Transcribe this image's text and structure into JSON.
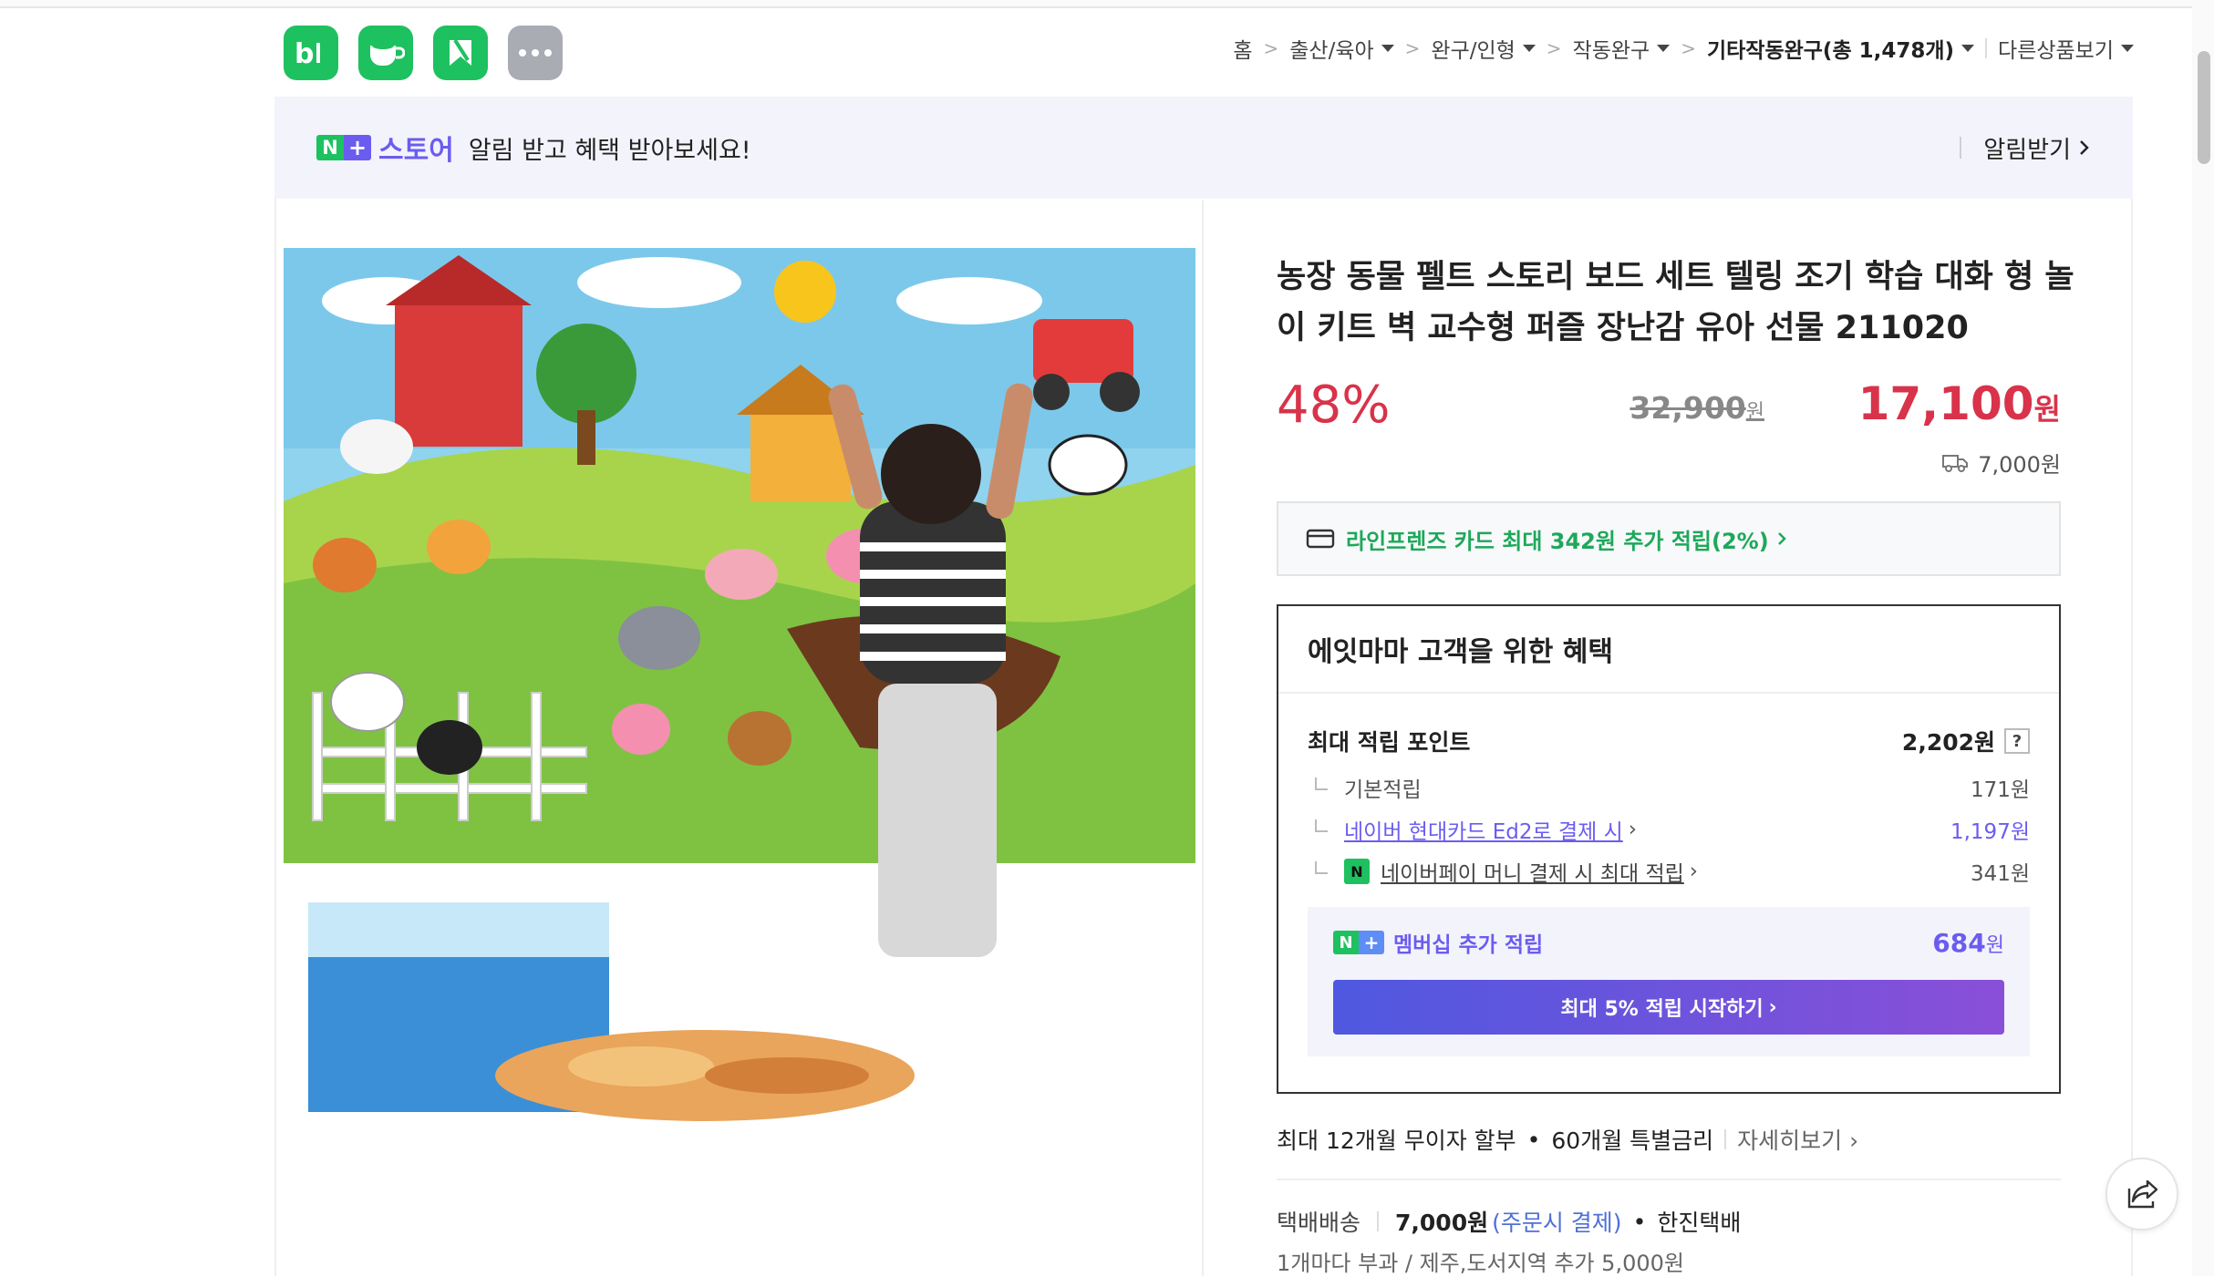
{
  "colors": {
    "green": "#1ec15f",
    "purple": "#6b5cf0",
    "red": "#d8334a",
    "grey_icon": "#a9acb3"
  },
  "apps": [
    {
      "name": "blog-icon"
    },
    {
      "name": "cafe-icon"
    },
    {
      "name": "post-icon"
    },
    {
      "name": "more-icon"
    }
  ],
  "breadcrumb": {
    "home": "홈",
    "c1": "출산/육아",
    "c2": "완구/인형",
    "c3": "작동완구",
    "c4": "기타작동완구(총 1,478개)",
    "other": "다른상품보기"
  },
  "store_bar": {
    "n": "N",
    "plus": "+",
    "store": "스토어",
    "message": "알림 받고 혜택 받아보세요!",
    "alarm": "알림받기"
  },
  "product": {
    "title": "농장 동물 펠트 스토리 보드 세트 텔링 조기 학습 대화 형 놀이 키트 벽 교수형 퍼즐 장난감 유아 선물 211020",
    "discount": "48%",
    "original_price": "32,900",
    "original_unit": "원",
    "sale_price": "17,100",
    "sale_unit": "원",
    "shipping_fee": "7,000원"
  },
  "card_benefit": "라인프렌즈 카드 최대 342원 추가 적립(2%)",
  "benefit": {
    "header": "에잇마마 고객을 위한 혜택",
    "max_points_label": "최대 적립 포인트",
    "max_points_value": "2,202원",
    "q": "?",
    "base_label": "기본적립",
    "base_value": "171원",
    "hyundai_label": "네이버 현대카드 Ed2로 결제 시",
    "hyundai_value": "1,197원",
    "npay_icon": "N",
    "npay_label": "네이버페이 머니 결제 시 최대 적립",
    "npay_value": "341원",
    "member_label": "멤버십 추가 적립",
    "member_value": "684",
    "member_unit": "원",
    "member_button": "최대 5% 적립 시작하기"
  },
  "installment": {
    "text1": "최대 12개월 무이자 할부",
    "dot": "•",
    "text2": "60개월 특별금리",
    "more": "자세히보기"
  },
  "delivery": {
    "label": "택배배송",
    "fee": "7,000원",
    "cod": "(주문시 결제)",
    "dot": "•",
    "carrier": "한진택배",
    "note": "1개마다 부과 / 제주,도서지역 추가 5,000원"
  }
}
